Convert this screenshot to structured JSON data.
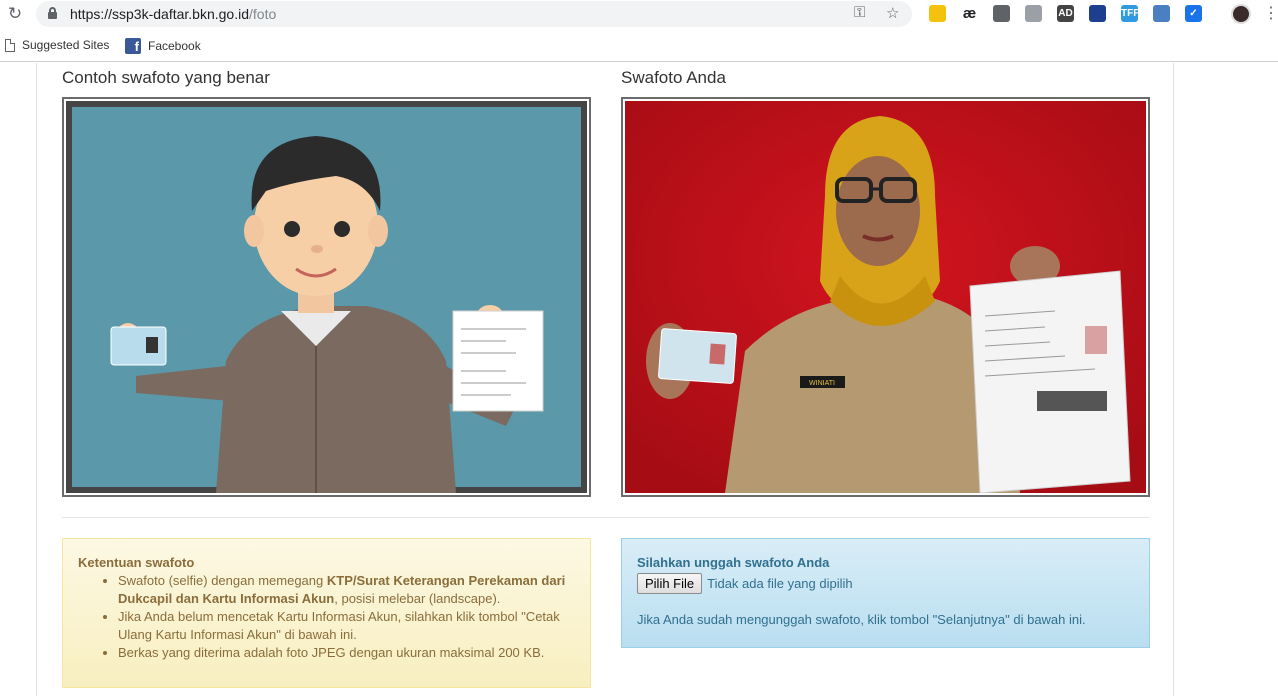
{
  "browser": {
    "url_host": "https://ssp3k-daftar.bkn.go.id",
    "url_path": "/foto",
    "bookmarks": [
      "Suggested Sites",
      "Facebook"
    ],
    "extensions": [
      {
        "name": "translate-extension-icon",
        "label": "",
        "color": "#f4c20d"
      },
      {
        "name": "ae-extension-icon",
        "label": "æ",
        "color": "transparent"
      },
      {
        "name": "pin-extension-icon",
        "label": "",
        "color": "#5f6368"
      },
      {
        "name": "drive-extension-icon",
        "label": "",
        "color": "#9aa0a6"
      },
      {
        "name": "ad-extension-icon",
        "label": "AD",
        "color": "#444"
      },
      {
        "name": "globe-extension-icon",
        "label": "",
        "color": "#1e3f8f"
      },
      {
        "name": "tff-extension-icon",
        "label": "TFF",
        "color": "#2f9ae0"
      },
      {
        "name": "image-extension-icon",
        "label": "",
        "color": "#4a7fc1"
      },
      {
        "name": "check-extension-icon",
        "label": "✓",
        "color": "#1a73e8"
      }
    ]
  },
  "example": {
    "heading": "Contoh swafoto yang benar"
  },
  "upload_preview": {
    "heading": "Swafoto Anda",
    "name_tag": "WINIATI"
  },
  "rules": {
    "title": "Ketentuan swafoto",
    "items": [
      {
        "pre": "Swafoto (selfie) dengan memegang ",
        "bold": "KTP/Surat Keterangan Perekaman dari Dukcapil dan Kartu Informasi Akun",
        "post": ", posisi melebar (landscape)."
      },
      {
        "pre": "Jika Anda belum mencetak Kartu Informasi Akun, silahkan klik tombol \"Cetak Ulang Kartu Informasi Akun\" di bawah ini.",
        "bold": "",
        "post": ""
      },
      {
        "pre": "Berkas yang diterima adalah foto JPEG dengan ukuran maksimal 200 KB.",
        "bold": "",
        "post": ""
      }
    ]
  },
  "upload": {
    "title": "Silahkan unggah swafoto Anda",
    "button_label": "Pilih File",
    "file_status": "Tidak ada file yang dipilih",
    "note": "Jika Anda sudah mengunggah swafoto, klik tombol \"Selanjutnya\" di bawah ini."
  }
}
